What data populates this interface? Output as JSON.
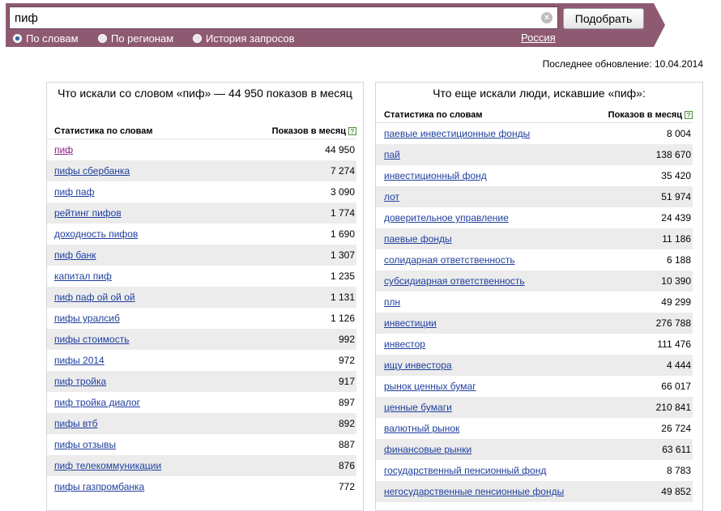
{
  "search": {
    "value": "пиф",
    "clear_symbol": "×",
    "submit_label": "Подобрать",
    "modes": [
      "По словам",
      "По регионам",
      "История запросов"
    ],
    "selected_mode": 0,
    "region": "Россия"
  },
  "last_update": "Последнее обновление: 10.04.2014",
  "left_panel": {
    "title": "Что искали со словом «пиф» — 44 950 показов в месяц",
    "col_words": "Статистика по словам",
    "col_shows": "Показов в месяц",
    "help_symbol": "?",
    "rows": [
      {
        "phrase": "пиф",
        "count": "44 950"
      },
      {
        "phrase": "пифы сбербанка",
        "count": "7 274"
      },
      {
        "phrase": "пиф паф",
        "count": "3 090"
      },
      {
        "phrase": "рейтинг пифов",
        "count": "1 774"
      },
      {
        "phrase": "доходность пифов",
        "count": "1 690"
      },
      {
        "phrase": "пиф банк",
        "count": "1 307"
      },
      {
        "phrase": "капитал пиф",
        "count": "1 235"
      },
      {
        "phrase": "пиф паф ой ой ой",
        "count": "1 131"
      },
      {
        "phrase": "пифы уралсиб",
        "count": "1 126"
      },
      {
        "phrase": "пифы стоимость",
        "count": "992"
      },
      {
        "phrase": "пифы 2014",
        "count": "972"
      },
      {
        "phrase": "пиф тройка",
        "count": "917"
      },
      {
        "phrase": "пиф тройка диалог",
        "count": "897"
      },
      {
        "phrase": "пифы втб",
        "count": "892"
      },
      {
        "phrase": "пифы отзывы",
        "count": "887"
      },
      {
        "phrase": "пиф телекоммуникации",
        "count": "876"
      },
      {
        "phrase": "пифы газпромбанка",
        "count": "772"
      }
    ]
  },
  "right_panel": {
    "title": "Что еще искали люди, искавшие «пиф»:",
    "col_words": "Статистика по словам",
    "col_shows": "Показов в месяц",
    "help_symbol": "?",
    "rows": [
      {
        "phrase": "паевые инвестиционные фонды",
        "count": "8 004"
      },
      {
        "phrase": "пай",
        "count": "138 670"
      },
      {
        "phrase": "инвестиционный фонд",
        "count": "35 420"
      },
      {
        "phrase": "лот",
        "count": "51 974"
      },
      {
        "phrase": "доверительное управление",
        "count": "24 439"
      },
      {
        "phrase": "паевые фонды",
        "count": "11 186"
      },
      {
        "phrase": "солидарная ответственность",
        "count": "6 188"
      },
      {
        "phrase": "субсидиарная ответственность",
        "count": "10 390"
      },
      {
        "phrase": "плн",
        "count": "49 299"
      },
      {
        "phrase": "инвестиции",
        "count": "276 788"
      },
      {
        "phrase": "инвестор",
        "count": "111 476"
      },
      {
        "phrase": "ищу инвестора",
        "count": "4 444"
      },
      {
        "phrase": "рынок ценных бумаг",
        "count": "66 017"
      },
      {
        "phrase": "ценные бумаги",
        "count": "210 841"
      },
      {
        "phrase": "валютный рынок",
        "count": "26 724"
      },
      {
        "phrase": "финансовые рынки",
        "count": "63 611"
      },
      {
        "phrase": "государственный пенсионный фонд",
        "count": "8 783"
      },
      {
        "phrase": "негосударственные пенсионные фонды",
        "count": "49 852"
      }
    ]
  }
}
